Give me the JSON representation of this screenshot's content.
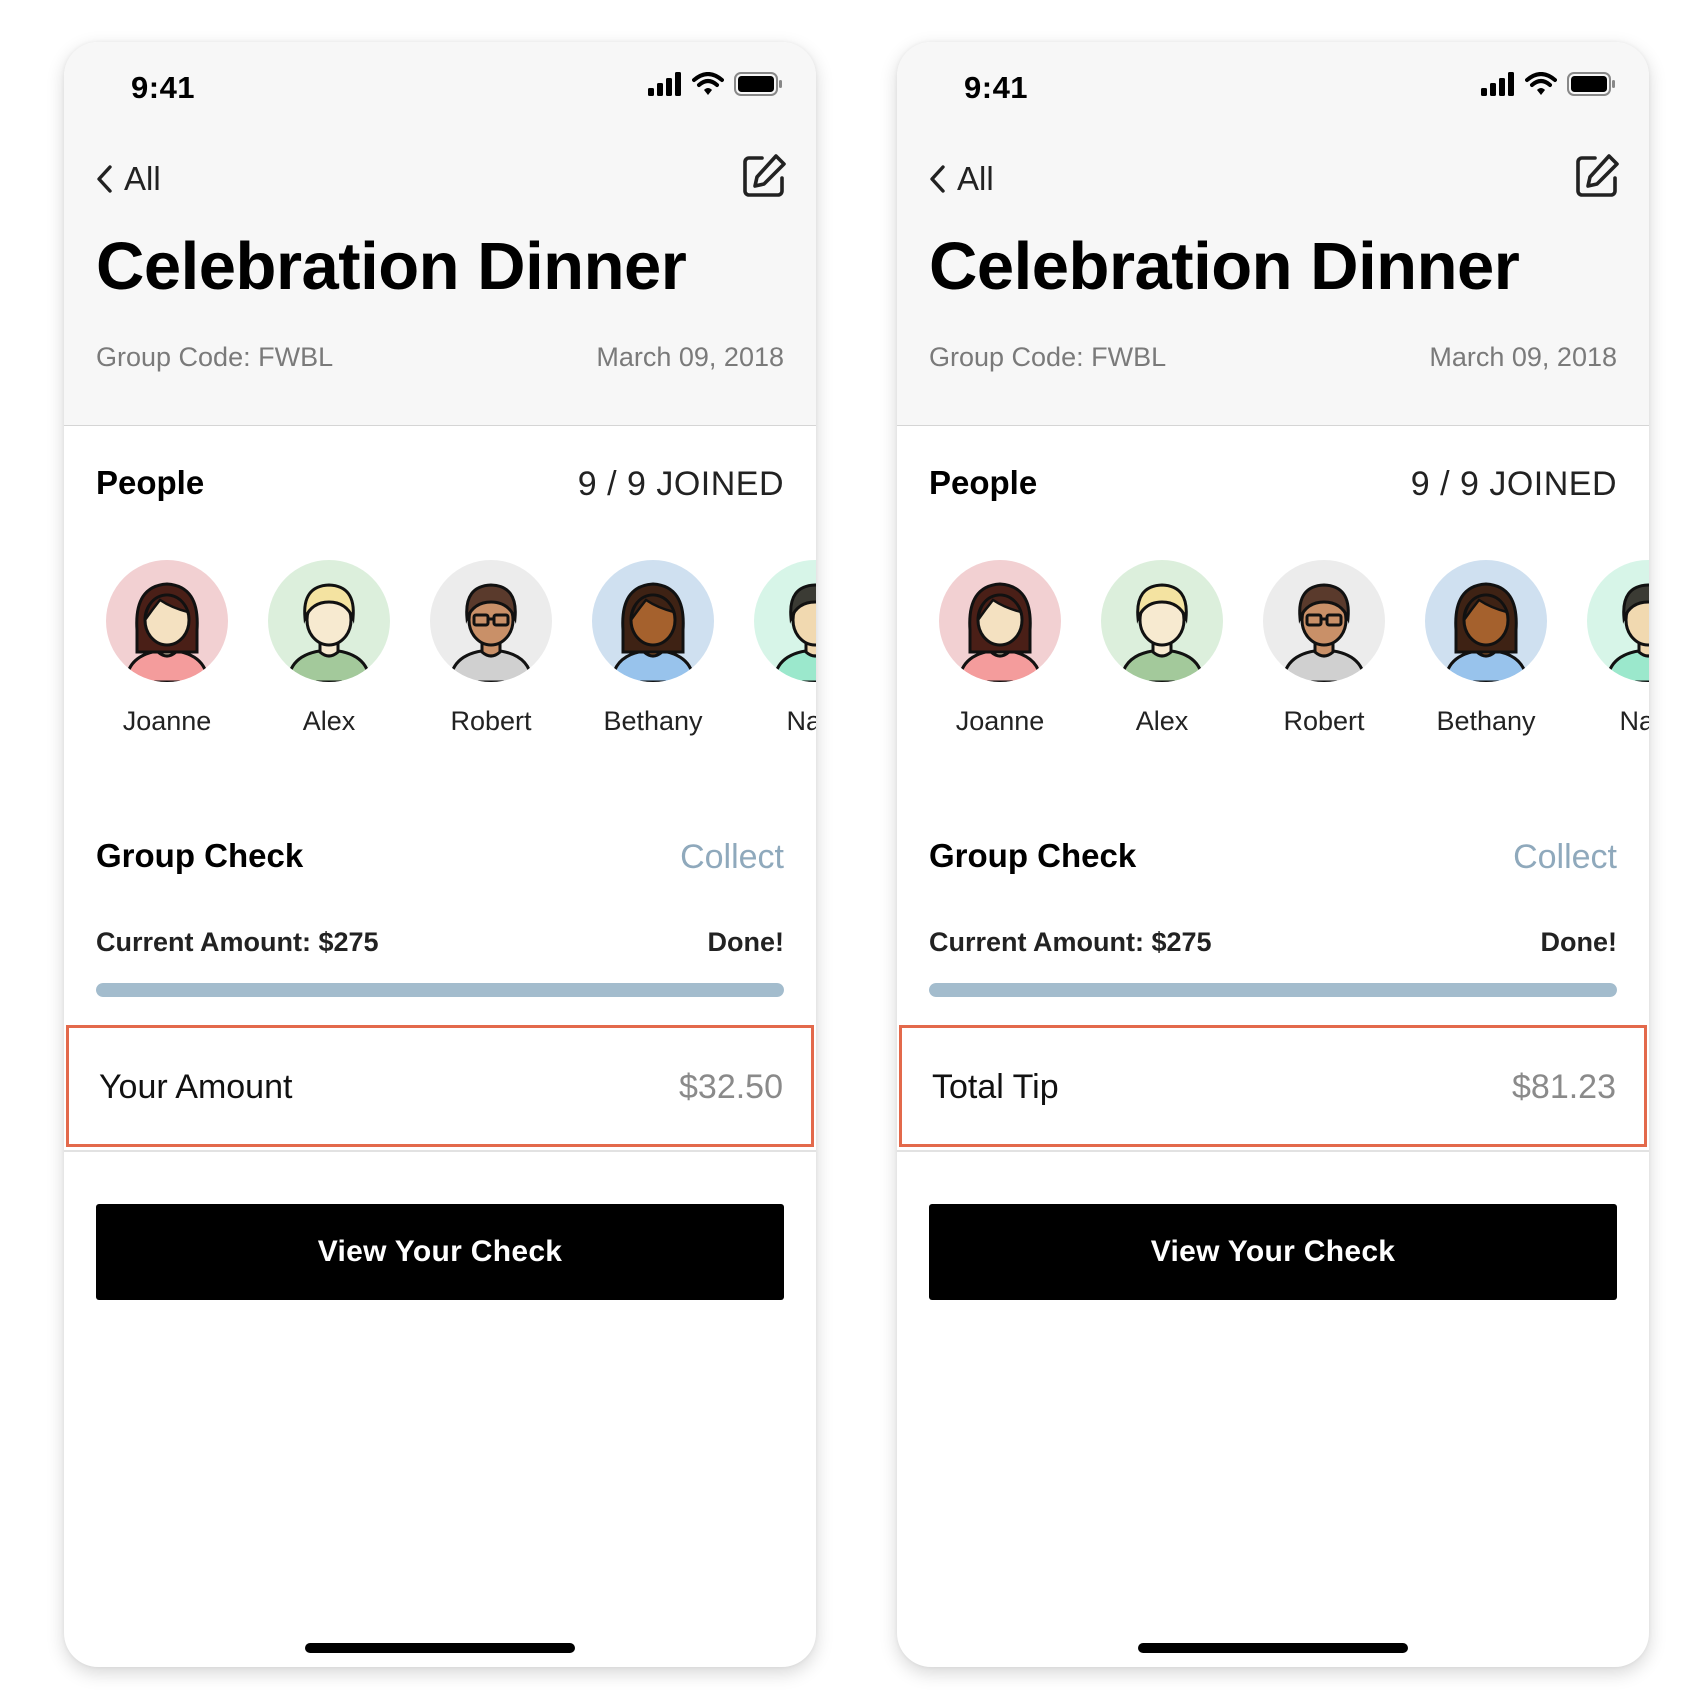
{
  "screens": [
    {
      "status": {
        "time": "9:41"
      },
      "nav": {
        "back_label": "All"
      },
      "title": "Celebration Dinner",
      "group_code": "Group Code: FWBL",
      "date": "March 09, 2018",
      "people": {
        "title": "People",
        "joined": "9 / 9 JOINED",
        "members": [
          {
            "name": "Joanne"
          },
          {
            "name": "Alex"
          },
          {
            "name": "Robert"
          },
          {
            "name": "Bethany"
          },
          {
            "name": "Nath"
          }
        ]
      },
      "group_check": {
        "title": "Group Check",
        "collect_label": "Collect",
        "current_amount": "Current Amount: $275",
        "status": "Done!",
        "progress": 1.0
      },
      "highlight_row": {
        "label": "Your Amount",
        "value": "$32.50"
      },
      "cta_label": "View Your Check"
    },
    {
      "status": {
        "time": "9:41"
      },
      "nav": {
        "back_label": "All"
      },
      "title": "Celebration Dinner",
      "group_code": "Group Code: FWBL",
      "date": "March 09, 2018",
      "people": {
        "title": "People",
        "joined": "9 / 9 JOINED",
        "members": [
          {
            "name": "Joanne"
          },
          {
            "name": "Alex"
          },
          {
            "name": "Robert"
          },
          {
            "name": "Bethany"
          },
          {
            "name": "Nath"
          }
        ]
      },
      "group_check": {
        "title": "Group Check",
        "collect_label": "Collect",
        "current_amount": "Current Amount: $275",
        "status": "Done!",
        "progress": 1.0
      },
      "highlight_row": {
        "label": "Total Tip",
        "value": "$81.23"
      },
      "cta_label": "View Your Check"
    }
  ],
  "colors": {
    "accent_muted": "#8fa9bc",
    "progress_fill": "#a3bccd",
    "highlight_border": "#e3694b",
    "cta_background": "#000000"
  },
  "avatar_styles": [
    {
      "icon": "woman-avatar-icon",
      "bg": "#f2d0d2",
      "hair": "#4a1f17",
      "skin": "#f4e1c1",
      "shirt": "#f49c9c"
    },
    {
      "icon": "man-blond-avatar-icon",
      "bg": "#dcefdc",
      "hair": "#f4e3a1",
      "skin": "#f7ead0",
      "shirt": "#a3c99b"
    },
    {
      "icon": "man-glasses-avatar-icon",
      "bg": "#ececec",
      "hair": "#5a3a2c",
      "skin": "#c99068",
      "shirt": "#d0d0d0"
    },
    {
      "icon": "woman-dark-avatar-icon",
      "bg": "#cfe0f0",
      "hair": "#3e2214",
      "skin": "#a5612d",
      "shirt": "#98c3ec"
    },
    {
      "icon": "man-avatar-icon",
      "bg": "#d7f5e8",
      "hair": "#3b3b34",
      "skin": "#f1d9b0",
      "shirt": "#9be8cc"
    }
  ]
}
